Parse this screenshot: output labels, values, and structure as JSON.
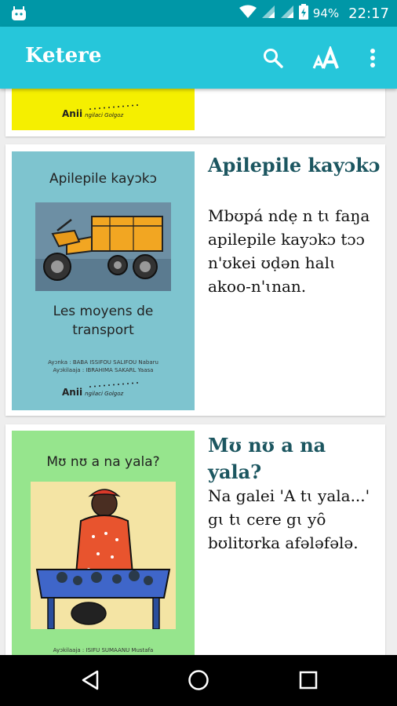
{
  "status_bar": {
    "battery": "94%",
    "time": "22:17"
  },
  "app_bar": {
    "title": "Ketere",
    "actions": [
      "search-icon",
      "text-size-icon",
      "more-vert-icon"
    ]
  },
  "books": [
    {
      "title": "",
      "description": "",
      "cover": {
        "background": "#f5ef00",
        "publisher": "Anii",
        "publisher_tagline": "ngilaci Golgoz"
      }
    },
    {
      "title": "Apilepile kayɔkɔ",
      "description": "Mbʊpá ndẹ n tɩ faŋa apilepile kayɔkɔ tɔɔ n'ʊkei ʊḍən halɩ akoo-n'ɩnan.",
      "cover": {
        "background": "#7ec4cf",
        "title_line": "Apilepile kayɔkɔ",
        "subtitle": "Les moyens de transport",
        "credit_author": "Ayɔnka : BABA ISSIFOU SALIFOU Nabaru",
        "credit_illustrator": "Ayɔkilaaja : IBRAHIMA SAKARL Yaasa",
        "publisher": "Anii",
        "publisher_tagline": "ngilaci Golgoz"
      }
    },
    {
      "title": "Mʊ nʊ a na yala?",
      "description": "Na galei 'A tɩ yala...' gɩ tɩ cere gɩ yȏ bʊlitʊrka afələfələ.",
      "cover": {
        "background": "#96e58d",
        "title_line": "Mʊ nʊ a na yala?",
        "credit_illustrator": "Ayɔkilaaja : ISIFU SUMAANU Mustafa"
      }
    }
  ],
  "colors": {
    "status_bar": "#0097a7",
    "app_bar": "#26c6da",
    "title_text": "#1c5660"
  },
  "nav_bar": [
    "back-icon",
    "home-icon",
    "recents-icon"
  ]
}
